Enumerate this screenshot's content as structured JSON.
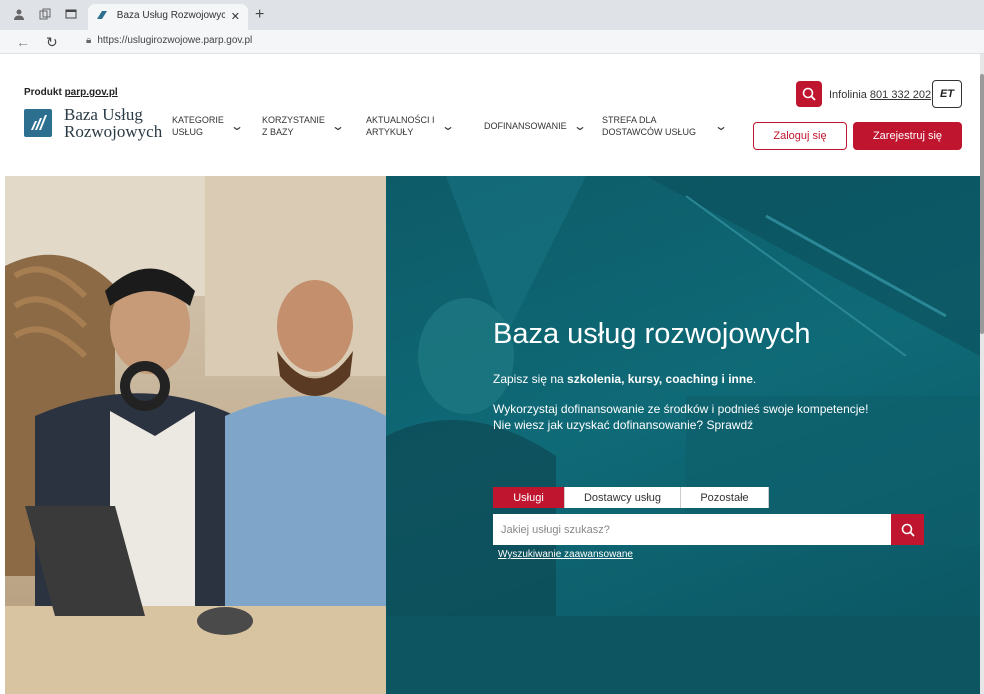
{
  "browser": {
    "tab_title": "Baza Usług Rozwojowych - Baza",
    "url": "https://uslugirozwojowe.parp.gov.pl"
  },
  "header": {
    "produkt_label": "Produkt",
    "produkt_link": "parp.gov.pl",
    "logo_line1": "Baza Usług",
    "logo_line2": "Rozwojowych",
    "nav": [
      {
        "line1": "KATEGORIE",
        "line2": "USŁUG"
      },
      {
        "line1": "KORZYSTANIE",
        "line2": "Z BAZY"
      },
      {
        "line1": "AKTUALNOŚCI I",
        "line2": "ARTYKUŁY"
      },
      {
        "line1": "DOFINANSOWANIE",
        "line2": ""
      },
      {
        "line1": "STREFA DLA",
        "line2": "DOSTAWCÓW USŁUG"
      }
    ],
    "infolinia_label": "Infolinia",
    "infolinia_number": "801 332 202",
    "lang_label": "ET",
    "login_label": "Zaloguj się",
    "register_label": "Zarejestruj się"
  },
  "hero": {
    "title": "Baza usług rozwojowych",
    "sub_prefix": "Zapisz się na ",
    "sub_bold": "szkolenia, kursy, coaching i inne",
    "sub_suffix": ".",
    "desc_line1": "Wykorzystaj dofinansowanie ze środków i podnieś swoje kompetencje!",
    "desc_line2_prefix": "Nie wiesz jak uzyskać dofinansowanie? ",
    "desc_line2_link": "Sprawdź",
    "search_tabs": [
      "Usługi",
      "Dostawcy usług",
      "Pozostałe"
    ],
    "search_placeholder": "Jakiej usługi szukasz?",
    "advanced_search": "Wyszukiwanie zaawansowane"
  },
  "colors": {
    "brand_red": "#c0152f",
    "hero_teal": "#0f6a77"
  }
}
